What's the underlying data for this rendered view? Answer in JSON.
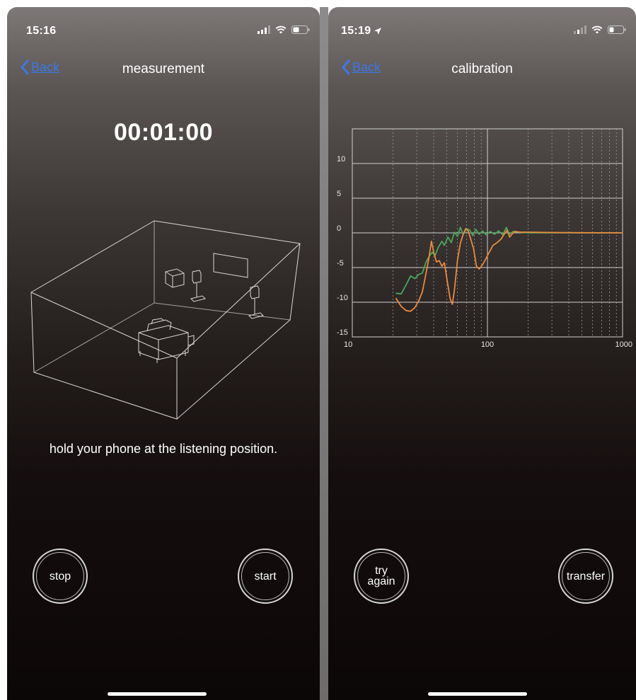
{
  "left_screen": {
    "status": {
      "time": "15:16"
    },
    "nav": {
      "back_label": "Back",
      "title": "measurement"
    },
    "timer": "00:01:00",
    "instruction": "hold your phone at the listening position.",
    "buttons": {
      "stop": "stop",
      "start": "start"
    },
    "illustration": "room-speaker-setup-diagram"
  },
  "right_screen": {
    "status": {
      "time": "15:19"
    },
    "nav": {
      "back_label": "Back",
      "title": "calibration"
    },
    "buttons": {
      "try_again": "try\nagain",
      "transfer": "transfer"
    }
  },
  "colors": {
    "accent_link": "#3c78e8",
    "series_green": "#4aa65a",
    "series_orange": "#e98a3c"
  },
  "chart_data": {
    "type": "line",
    "x_scale": "log",
    "xlim": [
      10,
      1000
    ],
    "ylim": [
      -15,
      15
    ],
    "x_ticks": [
      "10",
      "100",
      "1000"
    ],
    "y_ticks": [
      "15",
      "10",
      "5",
      "0",
      "-5",
      "-10",
      "-15"
    ],
    "grid": true,
    "series": [
      {
        "color": "#4aa65a",
        "points": [
          [
            21,
            -8.7
          ],
          [
            23,
            -8.8
          ],
          [
            25,
            -7.5
          ],
          [
            27,
            -6.2
          ],
          [
            29,
            -6.6
          ],
          [
            31,
            -6.0
          ],
          [
            33,
            -5.8
          ],
          [
            35,
            -4.3
          ],
          [
            37,
            -3.4
          ],
          [
            39,
            -2.8
          ],
          [
            41,
            -3.3
          ],
          [
            43,
            -2.2
          ],
          [
            46,
            -1.2
          ],
          [
            48,
            -1.8
          ],
          [
            51,
            -0.6
          ],
          [
            54,
            -1.4
          ],
          [
            57,
            0.1
          ],
          [
            60,
            -0.5
          ],
          [
            63,
            0.8
          ],
          [
            66,
            -0.2
          ],
          [
            70,
            0.6
          ],
          [
            74,
            0.4
          ],
          [
            78,
            -0.4
          ],
          [
            82,
            0.5
          ],
          [
            87,
            -0.2
          ],
          [
            92,
            0.3
          ],
          [
            98,
            -0.3
          ],
          [
            105,
            0.2
          ],
          [
            113,
            -0.2
          ],
          [
            121,
            0.3
          ],
          [
            130,
            -0.3
          ],
          [
            138,
            0.8
          ],
          [
            145,
            -0.2
          ],
          [
            155,
            0.2
          ],
          [
            170,
            0.1
          ],
          [
            200,
            0.0
          ],
          [
            300,
            0.0
          ],
          [
            500,
            0.0
          ],
          [
            1000,
            0.0
          ]
        ]
      },
      {
        "color": "#e98a3c",
        "points": [
          [
            21,
            -9.4
          ],
          [
            23,
            -10.6
          ],
          [
            25,
            -11.2
          ],
          [
            27,
            -11.3
          ],
          [
            29,
            -10.8
          ],
          [
            31,
            -9.8
          ],
          [
            33,
            -8.5
          ],
          [
            35,
            -6.0
          ],
          [
            37,
            -3.5
          ],
          [
            38.5,
            -1.2
          ],
          [
            40,
            -2.8
          ],
          [
            42,
            -4.2
          ],
          [
            44,
            -4.0
          ],
          [
            46,
            -4.8
          ],
          [
            48,
            -4.3
          ],
          [
            50,
            -6.5
          ],
          [
            53,
            -9.5
          ],
          [
            55,
            -10.3
          ],
          [
            57,
            -8.2
          ],
          [
            60,
            -4.0
          ],
          [
            63,
            -1.5
          ],
          [
            66,
            -0.3
          ],
          [
            69,
            0.6
          ],
          [
            72,
            0.3
          ],
          [
            75,
            -0.8
          ],
          [
            79,
            -2.3
          ],
          [
            83,
            -4.8
          ],
          [
            87,
            -5.2
          ],
          [
            92,
            -4.6
          ],
          [
            97,
            -3.8
          ],
          [
            103,
            -2.8
          ],
          [
            110,
            -1.8
          ],
          [
            118,
            -1.4
          ],
          [
            126,
            -0.9
          ],
          [
            134,
            -0.1
          ],
          [
            140,
            0.4
          ],
          [
            146,
            -0.6
          ],
          [
            153,
            -0.1
          ],
          [
            160,
            0.2
          ],
          [
            175,
            0.1
          ],
          [
            200,
            0.1
          ],
          [
            300,
            0.05
          ],
          [
            500,
            0.02
          ],
          [
            1000,
            0.0
          ]
        ]
      }
    ]
  }
}
